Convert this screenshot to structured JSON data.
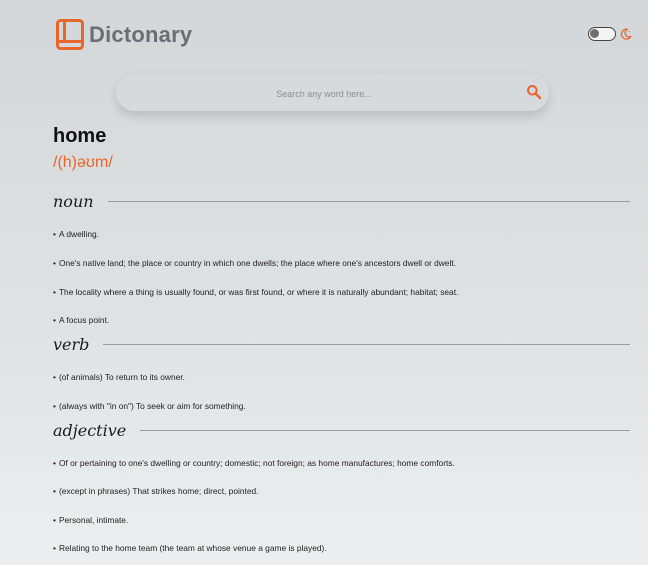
{
  "header": {
    "brand": "Dictonary"
  },
  "search": {
    "placeholder": "Search any word here..."
  },
  "entry": {
    "word": "home",
    "phonetic": "/(h)əʊm/"
  },
  "meanings": [
    {
      "part_of_speech": "noun",
      "definitions": [
        "A dwelling.",
        "One's native land; the place or country in which one dwells; the place where one's ancestors dwell or dwelt.",
        "The locality where a thing is usually found, or was first found, or where it is naturally abundant; habitat; seat.",
        "A focus point."
      ]
    },
    {
      "part_of_speech": "verb",
      "definitions": [
        "(of animals) To return to its owner.",
        "(always with \"in on\") To seek or aim for something."
      ]
    },
    {
      "part_of_speech": "adjective",
      "definitions": [
        "Of or pertaining to one's dwelling or country; domestic; not foreign; as home manufactures; home comforts.",
        "(except in phrases) That strikes home; direct, pointed.",
        "Personal, intimate.",
        "Relating to the home team (the team at whose venue a game is played)."
      ]
    }
  ],
  "bullet": "•",
  "colors": {
    "accent": "#e8652c",
    "brand_text": "#6b6f74"
  },
  "icons": {
    "logo": "book-icon",
    "theme": "moon-icon",
    "search": "search-icon"
  },
  "theme_toggle": {
    "dark_mode": false
  }
}
